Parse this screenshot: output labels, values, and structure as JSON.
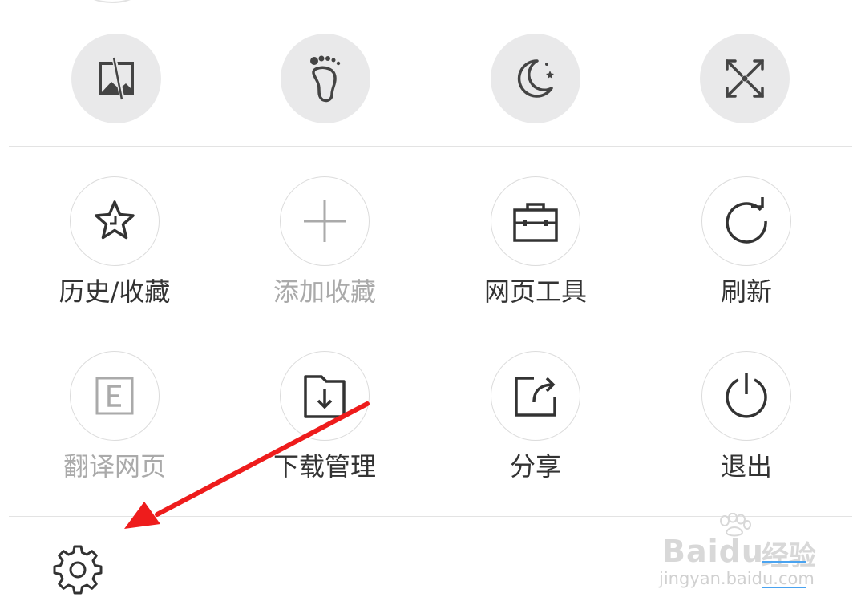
{
  "quick_toggles": [
    {
      "name": "no-image-mode",
      "icon": "no-image-icon"
    },
    {
      "name": "footprint-mode",
      "icon": "footprint-icon"
    },
    {
      "name": "night-mode",
      "icon": "moon-stars-icon"
    },
    {
      "name": "fullscreen",
      "icon": "fullscreen-icon"
    }
  ],
  "menu": {
    "items": [
      {
        "label": "历史/收藏",
        "icon": "star-clock-icon",
        "enabled": true
      },
      {
        "label": "添加收藏",
        "icon": "plus-icon",
        "enabled": false
      },
      {
        "label": "网页工具",
        "icon": "toolbox-icon",
        "enabled": true
      },
      {
        "label": "刷新",
        "icon": "refresh-icon",
        "enabled": true
      },
      {
        "label": "翻译网页",
        "icon": "translate-icon",
        "enabled": false
      },
      {
        "label": "下载管理",
        "icon": "download-folder-icon",
        "enabled": true
      },
      {
        "label": "分享",
        "icon": "share-icon",
        "enabled": true
      },
      {
        "label": "退出",
        "icon": "power-icon",
        "enabled": true
      }
    ]
  },
  "footer": {
    "settings_icon": "gear-icon"
  },
  "annotation": {
    "color": "#ee1c1c"
  },
  "watermark": {
    "brand": "Baidu",
    "cn": "经验",
    "url": "jingyan.baidu.com"
  }
}
